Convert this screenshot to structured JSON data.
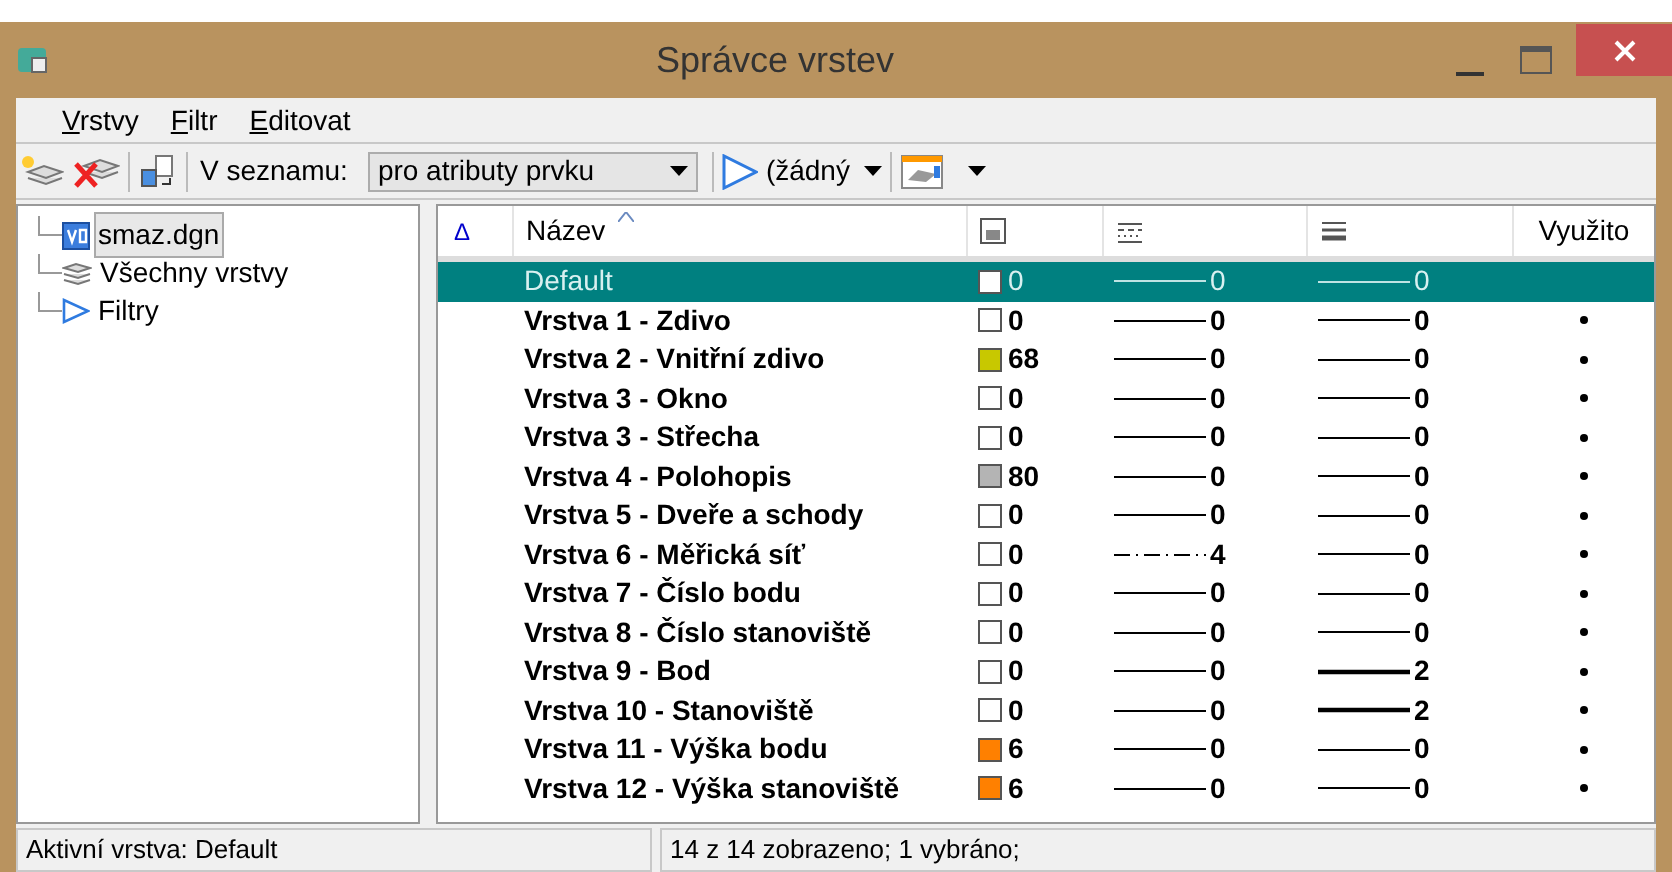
{
  "window": {
    "title": "Správce vrstev"
  },
  "menu": [
    {
      "label": "V",
      "rest": "rstvy"
    },
    {
      "label": "F",
      "rest": "iltr"
    },
    {
      "label": "E",
      "rest": "ditovat"
    }
  ],
  "toolbar": {
    "list_label": "V seznamu:",
    "list_value": "pro atributy prvku",
    "filter_value": "(žádný"
  },
  "tree": [
    {
      "label": "smaz.dgn",
      "kind": "file",
      "selected": true
    },
    {
      "label": "Všechny vrstvy",
      "kind": "layers",
      "selected": false
    },
    {
      "label": "Filtry",
      "kind": "filter",
      "selected": false
    }
  ],
  "table": {
    "sort_mark": "Δ",
    "columns": [
      {
        "kind": "text",
        "label": "Název"
      },
      {
        "kind": "color-icon"
      },
      {
        "kind": "style-icon"
      },
      {
        "kind": "weight-icon"
      },
      {
        "kind": "text",
        "label": "Využito"
      }
    ],
    "rows": [
      {
        "name": "Default",
        "color": "#ffffff",
        "color_no": "0",
        "kind": "solid",
        "style_no": "0",
        "weight_no": "0",
        "used": false,
        "selected": true
      },
      {
        "name": "Vrstva 1 - Zdivo",
        "color": "#ffffff",
        "color_no": "0",
        "kind": "solid",
        "style_no": "0",
        "weight_no": "0",
        "used": true,
        "selected": false
      },
      {
        "name": "Vrstva 2 - Vnitřní zdivo",
        "color": "#c8c800",
        "color_no": "68",
        "kind": "solid",
        "style_no": "0",
        "weight_no": "0",
        "used": true,
        "selected": false
      },
      {
        "name": "Vrstva 3 - Okno",
        "color": "#ffffff",
        "color_no": "0",
        "kind": "solid",
        "style_no": "0",
        "weight_no": "0",
        "used": true,
        "selected": false
      },
      {
        "name": "Vrstva 3 - Střecha",
        "color": "#ffffff",
        "color_no": "0",
        "kind": "solid",
        "style_no": "0",
        "weight_no": "0",
        "used": true,
        "selected": false
      },
      {
        "name": "Vrstva 4 - Polohopis",
        "color": "#b4b4b4",
        "color_no": "80",
        "kind": "solid",
        "style_no": "0",
        "weight_no": "0",
        "used": true,
        "selected": false
      },
      {
        "name": "Vrstva 5 - Dveře a schody",
        "color": "#ffffff",
        "color_no": "0",
        "kind": "solid",
        "style_no": "0",
        "weight_no": "0",
        "used": true,
        "selected": false
      },
      {
        "name": "Vrstva 6 - Měřická síť",
        "color": "#ffffff",
        "color_no": "0",
        "kind": "dash-dot",
        "style_no": "4",
        "weight_no": "0",
        "used": true,
        "selected": false
      },
      {
        "name": "Vrstva 7 - Číslo bodu",
        "color": "#ffffff",
        "color_no": "0",
        "kind": "solid",
        "style_no": "0",
        "weight_no": "0",
        "used": true,
        "selected": false
      },
      {
        "name": "Vrstva 8 - Číslo stanoviště",
        "color": "#ffffff",
        "color_no": "0",
        "kind": "solid",
        "style_no": "0",
        "weight_no": "0",
        "used": true,
        "selected": false
      },
      {
        "name": "Vrstva 9 - Bod",
        "color": "#ffffff",
        "color_no": "0",
        "kind": "solid",
        "style_no": "0",
        "weight_no": "2",
        "used": true,
        "selected": false
      },
      {
        "name": "Vrstva 10 - Stanoviště",
        "color": "#ffffff",
        "color_no": "0",
        "kind": "solid",
        "style_no": "0",
        "weight_no": "2",
        "used": true,
        "selected": false
      },
      {
        "name": "Vrstva 11 - Výška bodu",
        "color": "#ff8000",
        "color_no": "6",
        "kind": "solid",
        "style_no": "0",
        "weight_no": "0",
        "used": true,
        "selected": false
      },
      {
        "name": "Vrstva 12 - Výška stanoviště",
        "color": "#ff8000",
        "color_no": "6",
        "kind": "solid",
        "style_no": "0",
        "weight_no": "0",
        "used": true,
        "selected": false
      }
    ]
  },
  "status_bar": [
    "Aktivní vrstva: Default",
    "14 z 14 zobrazeno; 1 vybráno;"
  ]
}
